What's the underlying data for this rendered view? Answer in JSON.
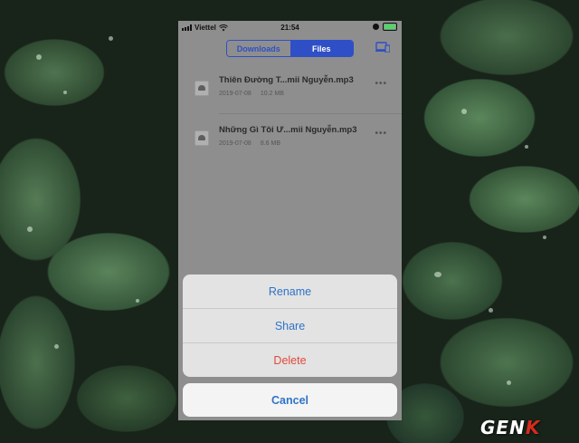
{
  "status_bar": {
    "carrier": "Viettel",
    "time": "21:54"
  },
  "tabs": [
    {
      "label": "Downloads",
      "active": false
    },
    {
      "label": "Files",
      "active": true
    }
  ],
  "files": [
    {
      "name": "Thiên Đường T...mii Nguyễn.mp3",
      "date": "2019-07-08",
      "size": "10.2 MB",
      "more": "•••"
    },
    {
      "name": "Những Gì Tôi Ư...mii Nguyễn.mp3",
      "date": "2019-07-08",
      "size": "8.6 MB",
      "more": "•••"
    }
  ],
  "action_sheet": {
    "items": [
      {
        "label": "Rename"
      },
      {
        "label": "Share"
      },
      {
        "label": "Delete"
      }
    ],
    "cancel": "Cancel"
  },
  "watermark": {
    "text": "GENK"
  },
  "colors": {
    "accent": "#2f4fc6",
    "action": "#2f73c9",
    "destructive": "#e2483d"
  },
  "icons": [
    "signal-icon",
    "wifi-icon",
    "moon-icon",
    "battery-icon",
    "devices-icon",
    "file-icon",
    "more-icon"
  ]
}
